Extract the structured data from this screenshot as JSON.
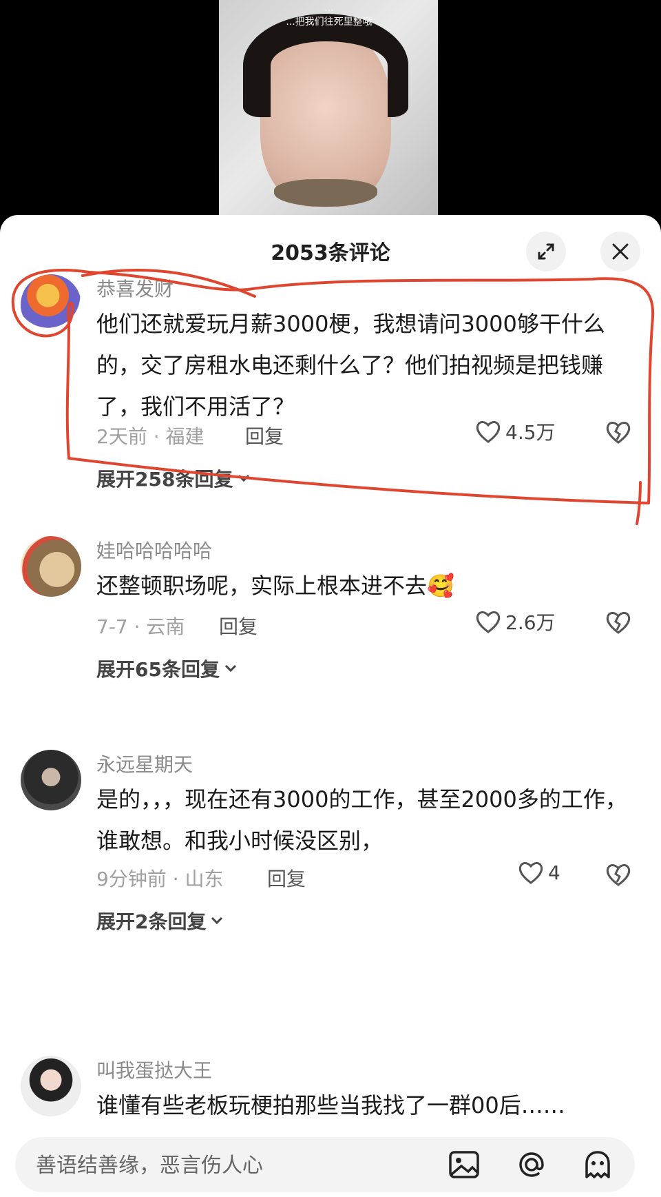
{
  "video": {
    "caption_line1": "...",
    "caption_line2": "...把我们往死里整哦"
  },
  "header": {
    "title": "2053条评论"
  },
  "comments": [
    {
      "username": "恭喜发财",
      "text": "他们还就爱玩月薪3000梗，我想请问3000够干什么的，交了房租水电还剩什么了？他们拍视频是把钱赚了，我们不用活了？",
      "meta": "2天前 · 福建",
      "reply_label": "回复",
      "likes": "4.5万",
      "expand_replies": "展开258条回复"
    },
    {
      "username": "娃哈哈哈哈哈",
      "text": "还整顿职场呢，实际上根本进不去🥰",
      "meta": "7-7 · 云南",
      "reply_label": "回复",
      "likes": "2.6万",
      "expand_replies": "展开65条回复"
    },
    {
      "username": "永远星期天",
      "text": "是的，，，现在还有3000的工作，甚至2000多的工作，谁敢想。和我小时候没区别，",
      "meta": "9分钟前 · 山东",
      "reply_label": "回复",
      "likes": "4",
      "expand_replies": "展开2条回复"
    },
    {
      "username": "叫我蛋挞大王",
      "text": "谁懂有些老板玩梗拍那些当我找了一群00后……"
    }
  ],
  "input": {
    "placeholder": "善语结善缘，恶言伤人心"
  },
  "colors": {
    "annotation_red": "#e0462f",
    "sheet_bg": "#ffffff",
    "muted_text": "#8a8a8a"
  }
}
